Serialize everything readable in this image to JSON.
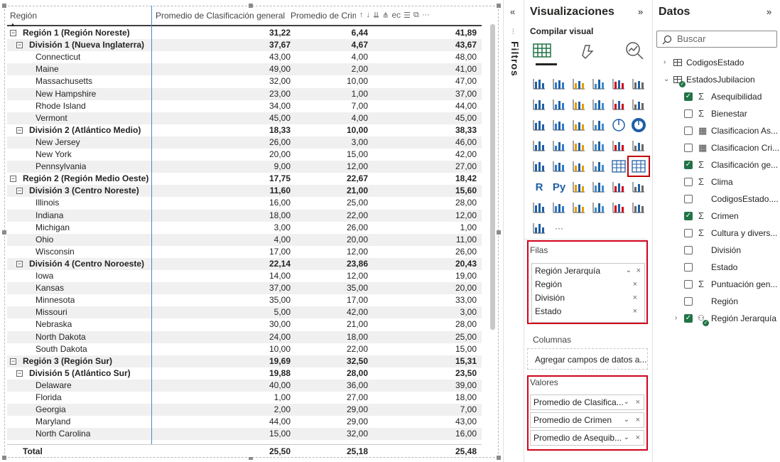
{
  "matrix": {
    "headers": [
      "Región",
      "Promedio de Clasificación general",
      "Promedio de Crim",
      "ec"
    ],
    "rows": [
      {
        "level": 0,
        "label": "Región 1 (Región Noreste)",
        "v1": "31,22",
        "v2": "6,44",
        "v3": "41,89",
        "expander": "⊟"
      },
      {
        "level": 1,
        "label": "División 1 (Nueva Inglaterra)",
        "v1": "37,67",
        "v2": "4,67",
        "v3": "43,67",
        "expander": "⊟"
      },
      {
        "level": 2,
        "label": "Connecticut",
        "v1": "43,00",
        "v2": "4,00",
        "v3": "48,00"
      },
      {
        "level": 2,
        "label": "Maine",
        "v1": "49,00",
        "v2": "2,00",
        "v3": "41,00"
      },
      {
        "level": 2,
        "label": "Massachusetts",
        "v1": "32,00",
        "v2": "10,00",
        "v3": "47,00"
      },
      {
        "level": 2,
        "label": "New Hampshire",
        "v1": "23,00",
        "v2": "1,00",
        "v3": "37,00"
      },
      {
        "level": 2,
        "label": "Rhode Island",
        "v1": "34,00",
        "v2": "7,00",
        "v3": "44,00"
      },
      {
        "level": 2,
        "label": "Vermont",
        "v1": "45,00",
        "v2": "4,00",
        "v3": "45,00"
      },
      {
        "level": 1,
        "label": "División 2 (Atlántico Medio)",
        "v1": "18,33",
        "v2": "10,00",
        "v3": "38,33",
        "expander": "⊟"
      },
      {
        "level": 2,
        "label": "New Jersey",
        "v1": "26,00",
        "v2": "3,00",
        "v3": "46,00"
      },
      {
        "level": 2,
        "label": "New York",
        "v1": "20,00",
        "v2": "15,00",
        "v3": "42,00"
      },
      {
        "level": 2,
        "label": "Pennsylvania",
        "v1": "9,00",
        "v2": "12,00",
        "v3": "27,00"
      },
      {
        "level": 0,
        "label": "Región 2 (Región Medio Oeste)",
        "v1": "17,75",
        "v2": "22,67",
        "v3": "18,42",
        "expander": "⊟"
      },
      {
        "level": 1,
        "label": "División 3 (Centro Noreste)",
        "v1": "11,60",
        "v2": "21,00",
        "v3": "15,60",
        "expander": "⊟"
      },
      {
        "level": 2,
        "label": "Illinois",
        "v1": "16,00",
        "v2": "25,00",
        "v3": "28,00"
      },
      {
        "level": 2,
        "label": "Indiana",
        "v1": "18,00",
        "v2": "22,00",
        "v3": "12,00"
      },
      {
        "level": 2,
        "label": "Michigan",
        "v1": "3,00",
        "v2": "26,00",
        "v3": "1,00"
      },
      {
        "level": 2,
        "label": "Ohio",
        "v1": "4,00",
        "v2": "20,00",
        "v3": "11,00"
      },
      {
        "level": 2,
        "label": "Wisconsin",
        "v1": "17,00",
        "v2": "12,00",
        "v3": "26,00"
      },
      {
        "level": 1,
        "label": "División 4 (Centro Noroeste)",
        "v1": "22,14",
        "v2": "23,86",
        "v3": "20,43",
        "expander": "⊟"
      },
      {
        "level": 2,
        "label": "Iowa",
        "v1": "14,00",
        "v2": "12,00",
        "v3": "19,00"
      },
      {
        "level": 2,
        "label": "Kansas",
        "v1": "37,00",
        "v2": "35,00",
        "v3": "20,00"
      },
      {
        "level": 2,
        "label": "Minnesota",
        "v1": "35,00",
        "v2": "17,00",
        "v3": "33,00"
      },
      {
        "level": 2,
        "label": "Missouri",
        "v1": "5,00",
        "v2": "42,00",
        "v3": "3,00"
      },
      {
        "level": 2,
        "label": "Nebraska",
        "v1": "30,00",
        "v2": "21,00",
        "v3": "28,00"
      },
      {
        "level": 2,
        "label": "North Dakota",
        "v1": "24,00",
        "v2": "18,00",
        "v3": "25,00"
      },
      {
        "level": 2,
        "label": "South Dakota",
        "v1": "10,00",
        "v2": "22,00",
        "v3": "15,00"
      },
      {
        "level": 0,
        "label": "Región 3 (Región Sur)",
        "v1": "19,69",
        "v2": "32,50",
        "v3": "15,31",
        "expander": "⊟"
      },
      {
        "level": 1,
        "label": "División 5 (Atlántico Sur)",
        "v1": "19,88",
        "v2": "28,00",
        "v3": "23,50",
        "expander": "⊟"
      },
      {
        "level": 2,
        "label": "Delaware",
        "v1": "40,00",
        "v2": "36,00",
        "v3": "39,00"
      },
      {
        "level": 2,
        "label": "Florida",
        "v1": "1,00",
        "v2": "27,00",
        "v3": "18,00"
      },
      {
        "level": 2,
        "label": "Georgia",
        "v1": "2,00",
        "v2": "29,00",
        "v3": "7,00"
      },
      {
        "level": 2,
        "label": "Maryland",
        "v1": "44,00",
        "v2": "29,00",
        "v3": "43,00"
      },
      {
        "level": 2,
        "label": "North Carolina",
        "v1": "15,00",
        "v2": "32,00",
        "v3": "16,00"
      }
    ],
    "total": {
      "label": "Total",
      "v1": "25,50",
      "v2": "25,18",
      "v3": "25,48"
    }
  },
  "filters": {
    "label": "Filtros",
    "collapse_glyph": "«"
  },
  "visualizations": {
    "title": "Visualizaciones",
    "expand_glyph": "»",
    "build_label": "Compilar visual",
    "more_glyph": "···",
    "wells": {
      "rows_label": "Filas",
      "rows_field": "Región Jerarquía",
      "rows_subfields": [
        "Región",
        "División",
        "Estado"
      ],
      "columns_label": "Columnas",
      "columns_placeholder": "Agregar campos de datos a...",
      "values_label": "Valores",
      "values_fields": [
        "Promedio de Clasifica...",
        "Promedio de Crimen",
        "Promedio de Asequib..."
      ]
    }
  },
  "data_pane": {
    "title": "Datos",
    "expand_glyph": "»",
    "search_placeholder": "Buscar",
    "tables": [
      {
        "name": "CodigosEstado",
        "expanded": false
      },
      {
        "name": "EstadosJubilacion",
        "expanded": true
      }
    ],
    "fields": [
      {
        "name": "Asequibilidad",
        "checked": true,
        "icon": "sigma"
      },
      {
        "name": "Bienestar",
        "checked": false,
        "icon": "sigma"
      },
      {
        "name": "Clasificacion As...",
        "checked": false,
        "icon": "calc"
      },
      {
        "name": "Clasificacion Cri...",
        "checked": false,
        "icon": "calc"
      },
      {
        "name": "Clasificación ge...",
        "checked": true,
        "icon": "sigma"
      },
      {
        "name": "Clima",
        "checked": false,
        "icon": "sigma"
      },
      {
        "name": "CodigosEstado....",
        "checked": false,
        "icon": "none"
      },
      {
        "name": "Crimen",
        "checked": true,
        "icon": "sigma"
      },
      {
        "name": "Cultura y divers...",
        "checked": false,
        "icon": "sigma"
      },
      {
        "name": "División",
        "checked": false,
        "icon": "none"
      },
      {
        "name": "Estado",
        "checked": false,
        "icon": "none"
      },
      {
        "name": "Puntuación gen...",
        "checked": false,
        "icon": "sigma"
      },
      {
        "name": "Región",
        "checked": false,
        "icon": "none"
      }
    ],
    "hierarchy": {
      "name": "Región Jerarquía",
      "checked": true
    }
  },
  "colors": {
    "accent_red": "#d0021b",
    "check_green": "#217346",
    "divider_blue": "#3a8dd1",
    "band": "#f0f0f0"
  }
}
